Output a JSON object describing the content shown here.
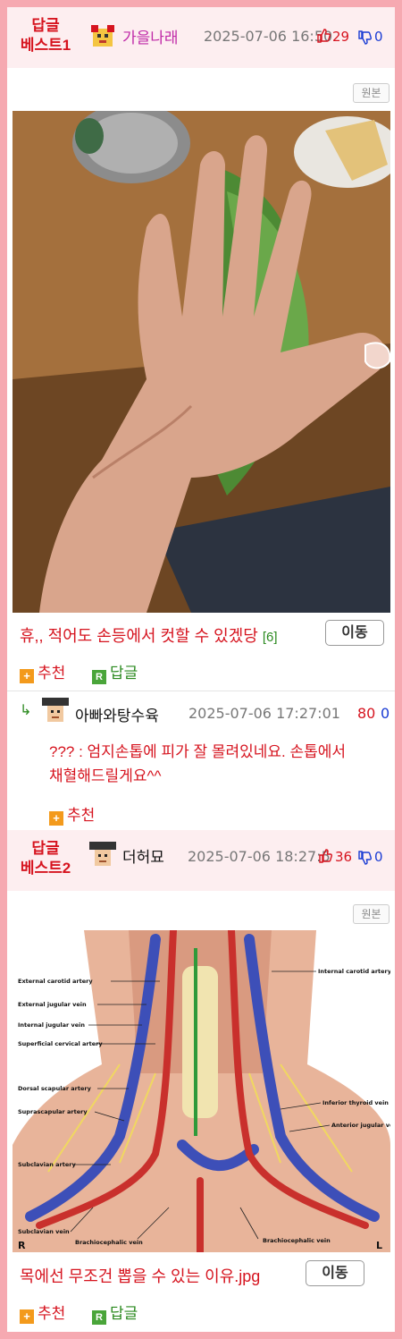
{
  "post1": {
    "badge_line1": "답글",
    "badge_line2": "베스트1",
    "author": "가을나래",
    "date": "2025-07-06 16:50",
    "up_count": "29",
    "down_count": "0",
    "original_label": "원본",
    "title": "휴,, 적어도 손등에서 컷할 수 있겠당",
    "comment_count": "[6]",
    "move_label": "이동",
    "recommend_label": "추천",
    "reply_label": "답글"
  },
  "comment1": {
    "author": "아빠와탕수육",
    "date": "2025-07-06 17:27:01",
    "up_count": "80",
    "down_count": "0",
    "text_line1": "??? : 엄지손톱에 피가 잘 몰려있네요. 손톱에서",
    "text_line2": "채혈해드릴게요^^",
    "recommend_label": "추천"
  },
  "post2": {
    "badge_line1": "답글",
    "badge_line2": "베스트2",
    "author": "더허묘",
    "date": "2025-07-06 18:27:5",
    "up_count": "36",
    "down_count": "0",
    "original_label": "원본",
    "title": "목에선 무조건 뽑을 수 있는 이유.jpg",
    "move_label": "이동",
    "recommend_label": "추천",
    "reply_label": "답글",
    "diagram_labels": {
      "external_carotid": "External carotid artery",
      "external_jugular": "External jugular vein",
      "internal_jugular": "Internal jugular vein",
      "superficial_cervical": "Superficial cervical artery",
      "dorsal_scapular": "Dorsal scapular artery",
      "suprascapular": "Suprascapular artery",
      "subclavian_artery": "Subclavian artery",
      "subclavian_vein": "Subclavian vein",
      "brachiocephalic_left": "Brachiocephalic vein",
      "brachiocephalic_right": "Brachiocephalic vein",
      "internal_carotid": "Internal carotid artery",
      "inferior_thyroid": "Inferior thyroid vein",
      "anterior_jugular": "Anterior jugular vein",
      "side_r": "R",
      "side_l": "L"
    }
  },
  "colors": {
    "accent_red": "#d6141f",
    "frame_pink": "#f6a9b1",
    "header_bg": "#fdeef0",
    "reply_green": "#2b8a1f",
    "down_blue": "#1a3cd4"
  }
}
